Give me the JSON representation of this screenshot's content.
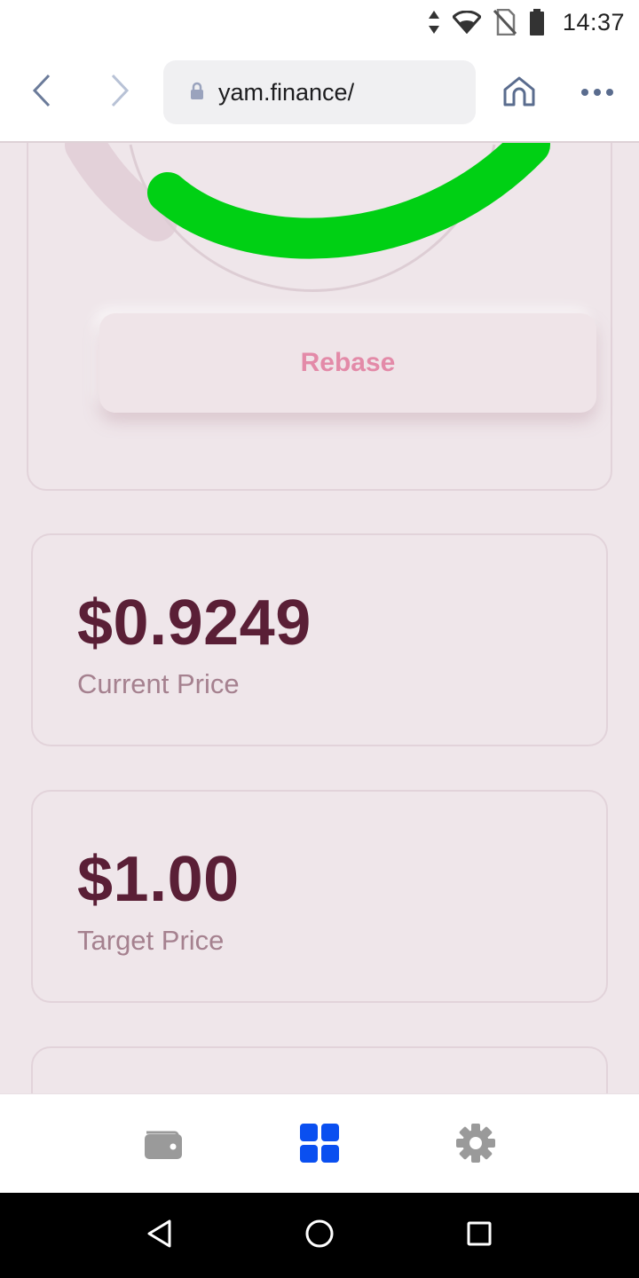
{
  "status_bar": {
    "time": "14:37",
    "icons": [
      "data-arrows-icon",
      "wifi-icon",
      "no-sim-icon",
      "battery-icon"
    ]
  },
  "browser": {
    "url": "yam.finance/",
    "icons": [
      "back-arrow-icon",
      "forward-arrow-icon",
      "lock-icon",
      "home-icon",
      "more-icon"
    ]
  },
  "rebase": {
    "button_label": "Rebase",
    "gauge_progress_color": "#00d014",
    "gauge_track_color": "#e3d1d9"
  },
  "prices": {
    "current": {
      "value": "$0.9249",
      "label": "Current Price"
    },
    "target": {
      "value": "$1.00",
      "label": "Target Price"
    }
  },
  "bottom_nav": {
    "items": [
      {
        "icon": "wallet-icon",
        "active": false
      },
      {
        "icon": "dashboard-grid-icon",
        "active": true
      },
      {
        "icon": "gear-icon",
        "active": false
      }
    ],
    "active_color": "#0a4ff0",
    "inactive_color": "#9a9a9a"
  },
  "android_nav": {
    "icons": [
      "triangle-back-icon",
      "circle-home-icon",
      "square-recents-icon"
    ]
  }
}
